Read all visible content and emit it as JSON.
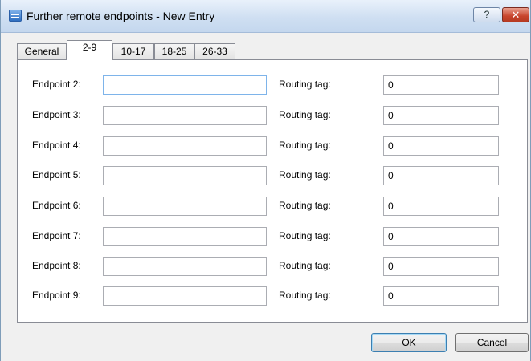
{
  "window": {
    "title": "Further remote endpoints - New Entry",
    "help_glyph": "?",
    "close_glyph": "✕"
  },
  "tabs": [
    {
      "label": "General",
      "active": false
    },
    {
      "label": "2-9",
      "active": true
    },
    {
      "label": "10-17",
      "active": false
    },
    {
      "label": "18-25",
      "active": false
    },
    {
      "label": "26-33",
      "active": false
    }
  ],
  "rows": [
    {
      "endpoint_label": "Endpoint 2:",
      "endpoint_value": "",
      "routing_label": "Routing tag:",
      "routing_value": "0"
    },
    {
      "endpoint_label": "Endpoint 3:",
      "endpoint_value": "",
      "routing_label": "Routing tag:",
      "routing_value": "0"
    },
    {
      "endpoint_label": "Endpoint 4:",
      "endpoint_value": "",
      "routing_label": "Routing tag:",
      "routing_value": "0"
    },
    {
      "endpoint_label": "Endpoint 5:",
      "endpoint_value": "",
      "routing_label": "Routing tag:",
      "routing_value": "0"
    },
    {
      "endpoint_label": "Endpoint 6:",
      "endpoint_value": "",
      "routing_label": "Routing tag:",
      "routing_value": "0"
    },
    {
      "endpoint_label": "Endpoint 7:",
      "endpoint_value": "",
      "routing_label": "Routing tag:",
      "routing_value": "0"
    },
    {
      "endpoint_label": "Endpoint 8:",
      "endpoint_value": "",
      "routing_label": "Routing tag:",
      "routing_value": "0"
    },
    {
      "endpoint_label": "Endpoint 9:",
      "endpoint_value": "",
      "routing_label": "Routing tag:",
      "routing_value": "0"
    }
  ],
  "buttons": {
    "ok_label": "OK",
    "cancel_label": "Cancel"
  }
}
